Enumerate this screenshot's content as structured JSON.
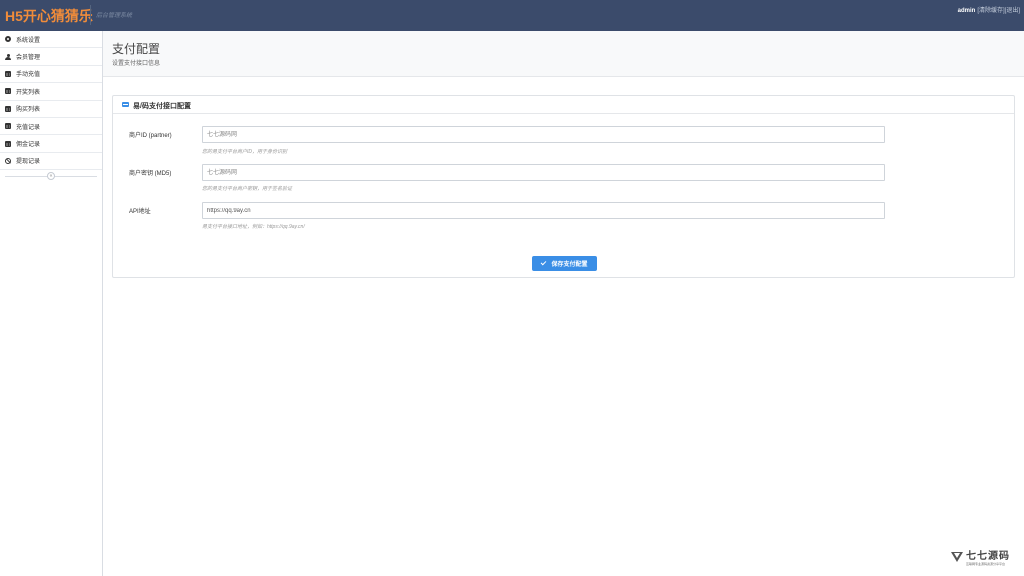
{
  "header": {
    "brand": "H5开心猜猜乐",
    "subtitle": "后台管理系统",
    "user": "admin",
    "links": [
      "[清除缓存]",
      "[退出]"
    ]
  },
  "sidebar": {
    "items": [
      {
        "label": "系统设置",
        "icon": "gear-icon"
      },
      {
        "label": "会员管理",
        "icon": "user-icon"
      },
      {
        "label": "手动充值",
        "icon": "calendar-icon"
      },
      {
        "label": "开奖列表",
        "icon": "calendar-icon"
      },
      {
        "label": "购买列表",
        "icon": "calendar-icon"
      },
      {
        "label": "充值记录",
        "icon": "calendar-icon"
      },
      {
        "label": "佣金记录",
        "icon": "calendar-icon"
      },
      {
        "label": "提现记录",
        "icon": "ban-icon"
      }
    ],
    "collapse_glyph": "«"
  },
  "page": {
    "title": "支付配置",
    "subtitle": "设置支付接口信息"
  },
  "panel": {
    "title": "易/码支付接口配置",
    "fields": [
      {
        "label": "商户ID (partner)",
        "value": "",
        "placeholder": "七七源码网",
        "help": "您的易支付平台商户ID，用于身份识别"
      },
      {
        "label": "商户密钥 (MD5)",
        "value": "",
        "placeholder": "七七源码网",
        "help": "您的易支付平台商户密钥，用于签名验证"
      },
      {
        "label": "API地址",
        "value": "https://qq.9ay.cn",
        "placeholder": "",
        "help": "易支付平台接口地址，例如：https://qq.9ay.cn/"
      }
    ],
    "save_label": "保存支付配置"
  },
  "watermark": {
    "name": "七七源码",
    "tagline": "互联网专业源码资源分享平台"
  },
  "colors": {
    "header_bg": "#3b4b6b",
    "brand": "#f08c3a",
    "accent": "#3a8ee6"
  }
}
